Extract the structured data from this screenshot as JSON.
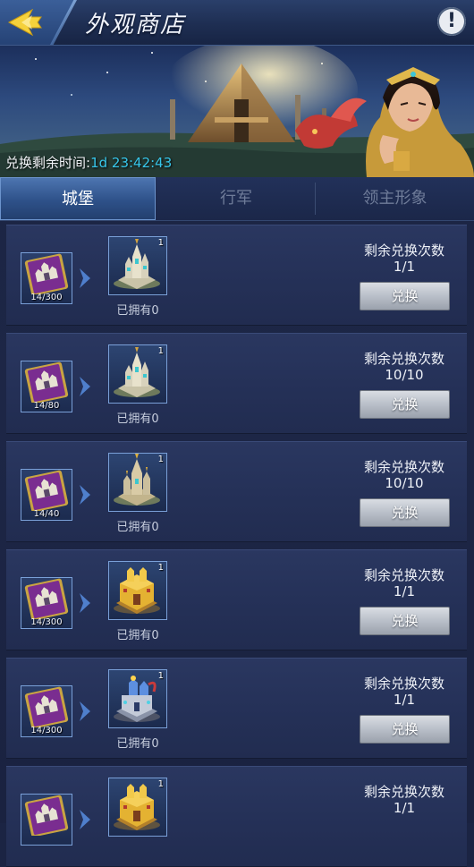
{
  "header": {
    "title": "外观商店"
  },
  "banner": {
    "timer_label": "兑换剩余时间:",
    "timer_value": "1d 23:42:43"
  },
  "tabs": [
    {
      "label": "城堡",
      "active": true
    },
    {
      "label": "行军",
      "active": false
    },
    {
      "label": "领主形象",
      "active": false
    }
  ],
  "items": [
    {
      "cost": "14/300",
      "reward_qty": "1",
      "owned": "已拥有0",
      "limit_label": "剩余兑换次数",
      "limit": "1/1",
      "button": "兑换",
      "reward_icon": "silver-castle-icon"
    },
    {
      "cost": "14/80",
      "reward_qty": "1",
      "owned": "已拥有0",
      "limit_label": "剩余兑换次数",
      "limit": "10/10",
      "button": "兑换",
      "reward_icon": "silver-castle-icon"
    },
    {
      "cost": "14/40",
      "reward_qty": "1",
      "owned": "已拥有0",
      "limit_label": "剩余兑换次数",
      "limit": "10/10",
      "button": "兑换",
      "reward_icon": "gold-spire-castle-icon"
    },
    {
      "cost": "14/300",
      "reward_qty": "1",
      "owned": "已拥有0",
      "limit_label": "剩余兑换次数",
      "limit": "1/1",
      "button": "兑换",
      "reward_icon": "golden-castle-icon"
    },
    {
      "cost": "14/300",
      "reward_qty": "1",
      "owned": "已拥有0",
      "limit_label": "剩余兑换次数",
      "limit": "1/1",
      "button": "兑换",
      "reward_icon": "blue-tech-castle-icon"
    },
    {
      "cost": "",
      "reward_qty": "1",
      "owned": "",
      "limit_label": "剩余兑换次数",
      "limit": "1/1",
      "button": "",
      "reward_icon": "golden-castle-icon"
    }
  ],
  "colors": {
    "timer": "#37c6ea",
    "accent": "#4d75b0"
  }
}
